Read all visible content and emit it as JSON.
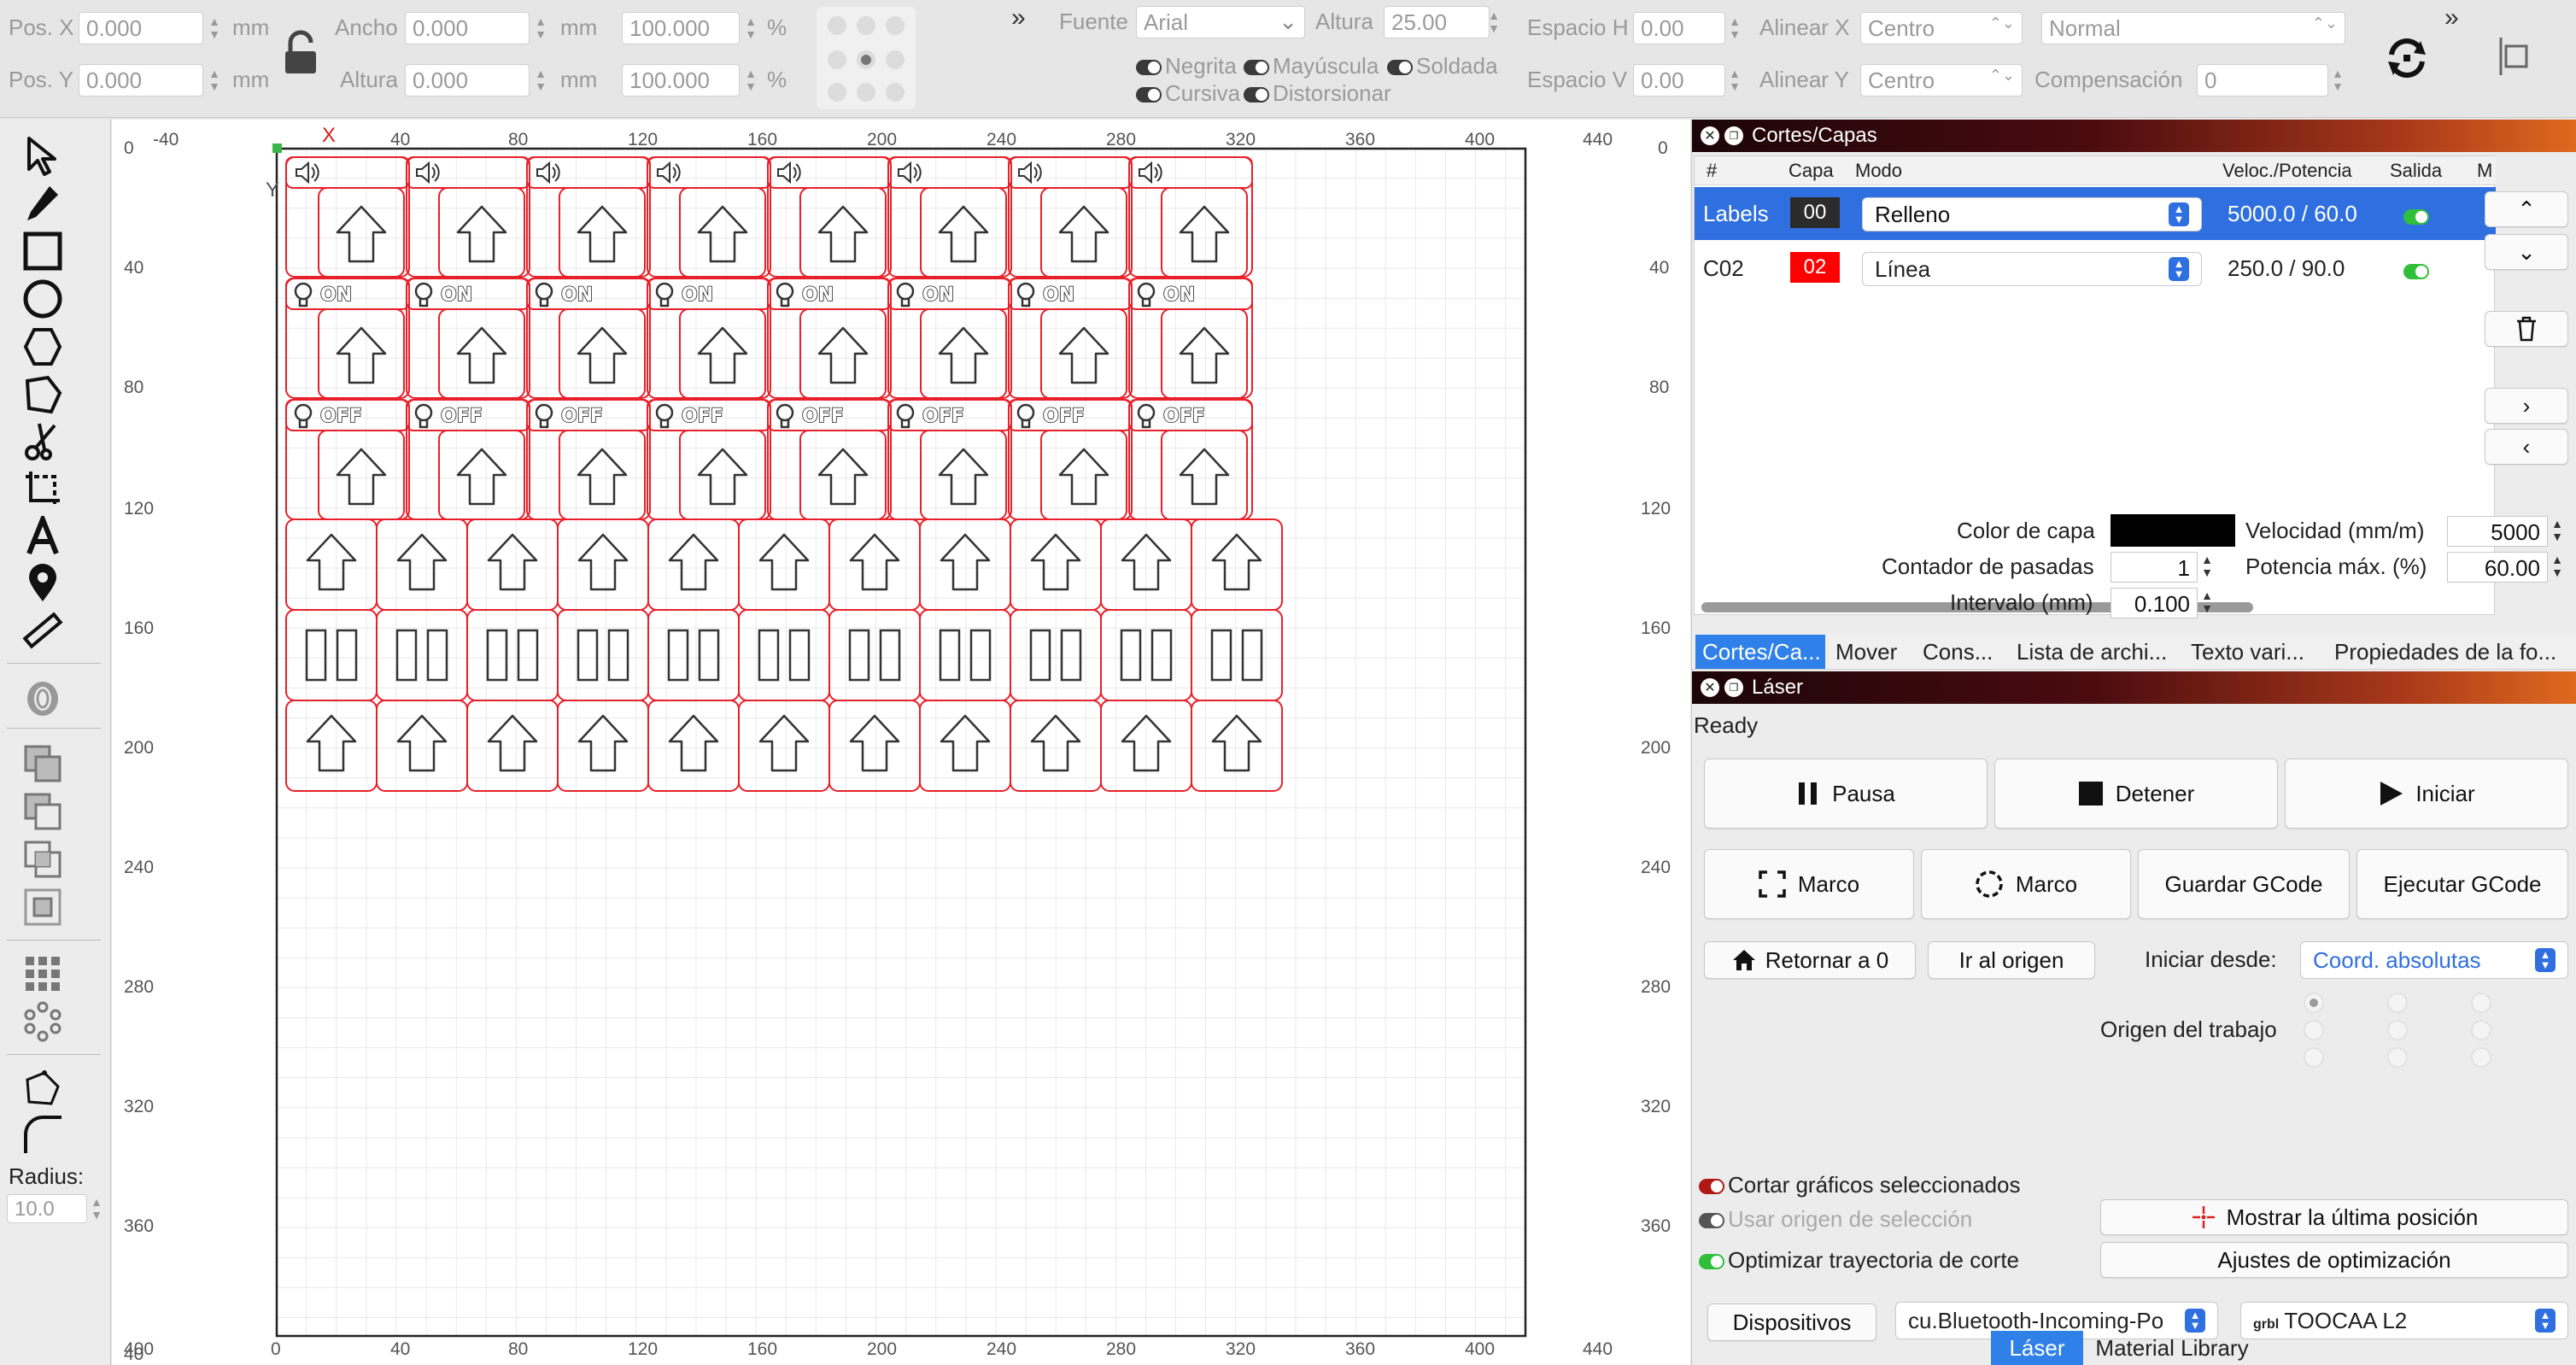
{
  "toolbar": {
    "pos_x_label": "Pos. X",
    "pos_x_value": "0.000",
    "pos_y_label": "Pos. Y",
    "pos_y_value": "0.000",
    "unit_mm": "mm",
    "ancho_label": "Ancho",
    "ancho_value": "0.000",
    "altura_label": "Altura",
    "altura_value": "0.000",
    "scale_w": "100.000",
    "scale_h": "100.000",
    "percent": "%",
    "fuente_label": "Fuente",
    "fuente_value": "Arial",
    "font_height_label": "Altura",
    "font_height_value": "25.00",
    "negrita": "Negrita",
    "mayuscula": "Mayúscula",
    "soldada": "Soldada",
    "cursiva": "Cursiva",
    "distorsionar": "Distorsionar",
    "espacio_h_label": "Espacio H",
    "espacio_h_value": "0.00",
    "espacio_v_label": "Espacio V",
    "espacio_v_value": "0.00",
    "alinear_x_label": "Alinear X",
    "alinear_x_value": "Centro",
    "alinear_y_label": "Alinear Y",
    "alinear_y_value": "Centro",
    "normal_value": "Normal",
    "compensacion_label": "Compensación",
    "compensacion_value": "0",
    "more": "»"
  },
  "tools": {
    "radius_label": "Radius:",
    "radius_value": "10.0"
  },
  "ruler": {
    "top_ticks": [
      "-40",
      "X",
      "40",
      "80",
      "120",
      "160",
      "200",
      "240",
      "280",
      "320",
      "360",
      "400",
      "440"
    ],
    "bottom_ticks": [
      "40",
      "0",
      "40",
      "80",
      "120",
      "160",
      "200",
      "240",
      "280",
      "320",
      "360",
      "400",
      "440"
    ],
    "left_ticks": [
      "0",
      "40",
      "80",
      "120",
      "160",
      "200",
      "240",
      "280",
      "320",
      "360",
      "400"
    ],
    "right_ticks": [
      "0",
      "40",
      "80",
      "120",
      "160",
      "200",
      "240",
      "280",
      "320",
      "360"
    ],
    "y_axis_letter": "Y"
  },
  "canvas_labels": {
    "on": "ON",
    "off": "OFF"
  },
  "cuts_panel": {
    "title": "Cortes/Capas",
    "headers": [
      "#",
      "Capa",
      "Modo",
      "Veloc./Potencia",
      "Salida",
      "M"
    ],
    "rows": [
      {
        "name": "Labels",
        "layer": "00",
        "mode": "Relleno",
        "speed_power": "5000.0 / 60.0",
        "layer_color": "#2b2b2b"
      },
      {
        "name": "C02",
        "layer": "02",
        "mode": "Línea",
        "speed_power": "250.0 / 90.0",
        "layer_color": "#ff0000"
      }
    ],
    "color_label": "Color de capa",
    "velocidad_label": "Velocidad (mm/m)",
    "velocidad_value": "5000",
    "pasadas_label": "Contador de pasadas",
    "pasadas_value": "1",
    "potencia_label": "Potencia máx. (%)",
    "potencia_value": "60.00",
    "intervalo_label": "Intervalo (mm)",
    "intervalo_value": "0.100",
    "tabs": [
      "Cortes/Ca...",
      "Mover",
      "Cons...",
      "Lista de archi...",
      "Texto vari...",
      "Propiedades de la fo..."
    ]
  },
  "laser_panel": {
    "title": "Láser",
    "status": "Ready",
    "pausa": "Pausa",
    "detener": "Detener",
    "iniciar": "Iniciar",
    "marco1": "Marco",
    "marco2": "Marco",
    "guardar": "Guardar GCode",
    "ejecutar": "Ejecutar GCode",
    "retornar": "Retornar a 0",
    "ir_origen": "Ir al origen",
    "iniciar_desde_label": "Iniciar desde:",
    "iniciar_desde_value": "Coord. absolutas",
    "origen_label": "Origen del trabajo",
    "cortar_sel": "Cortar gráficos seleccionados",
    "usar_origen": "Usar origen de selección",
    "optimizar": "Optimizar trayectoria de corte",
    "mostrar_pos": "Mostrar la última posición",
    "ajustes_opt": "Ajustes de optimización",
    "dispositivos": "Dispositivos",
    "port_value": "cu.Bluetooth-Incoming-Po",
    "device_value": "TOOCAA L2",
    "grbl": "grbl"
  },
  "bottom_tabs": [
    "Láser",
    "Material Library"
  ],
  "colors": {
    "accent_blue": "#2f80e8",
    "cut_red": "#e8202a",
    "canvas_grid": "#e4e4e4"
  }
}
